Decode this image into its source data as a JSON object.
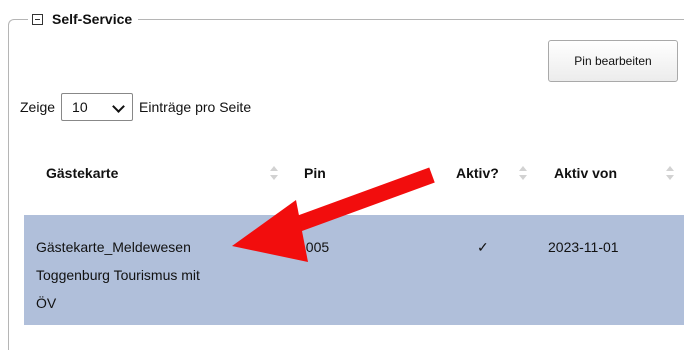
{
  "fieldset": {
    "title": "Self-Service",
    "collapse_icon": "minus-box-icon"
  },
  "toolbar": {
    "edit_pin_label": "Pin bearbeiten"
  },
  "length": {
    "prefix": "Zeige",
    "selected": "10",
    "suffix": "Einträge pro Seite"
  },
  "table": {
    "columns": [
      "Gästekarte",
      "Pin",
      "Aktiv?",
      "Aktiv von"
    ],
    "sorted_column": "Pin",
    "rows": [
      {
        "name_lines": [
          "Gästekarte_Meldewesen",
          "Toggenburg Tourismus mit",
          "ÖV"
        ],
        "pin": "1005",
        "aktiv": "✓",
        "aktiv_von": "2023-11-01"
      }
    ],
    "selected_row_color": "#b0bfda"
  },
  "annotation": {
    "arrow_color": "#f20d0d"
  }
}
